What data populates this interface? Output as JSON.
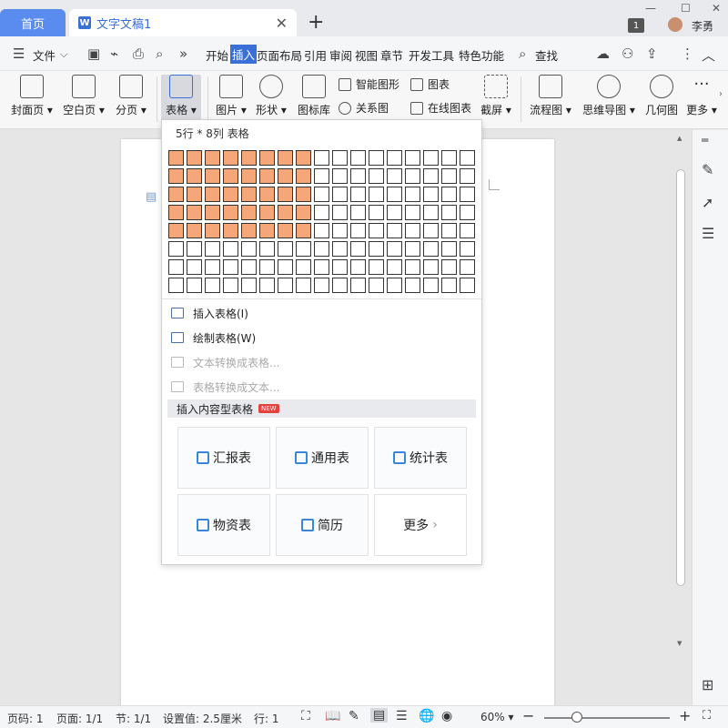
{
  "titlebar": {
    "home_tab": "首页",
    "doc_tab": "文字文稿1",
    "doc_icon_letter": "W",
    "badge": "1",
    "user_name": "李勇"
  },
  "menubar": {
    "file": "文件",
    "tabs": [
      "开始",
      "插入",
      "页面布局",
      "引用",
      "审阅",
      "视图",
      "章节",
      "开发工具",
      "特色功能"
    ],
    "active_tab": "插入",
    "search": "查找"
  },
  "ribbon": {
    "cover_page": "封面页",
    "blank_page": "空白页",
    "page_break": "分页",
    "table": "表格",
    "picture": "图片",
    "shapes": "形状",
    "icon_lib": "图标库",
    "smart_shape": "智能图形",
    "chart": "图表",
    "relation": "关系图",
    "online_chart": "在线图表",
    "screenshot": "截屏",
    "flowchart": "流程图",
    "mindmap": "思维导图",
    "geometry": "几何图",
    "more": "更多"
  },
  "dropdown": {
    "title": "5行 * 8列 表格",
    "rows_selected": 5,
    "cols_selected": 8,
    "grid_rows": 8,
    "grid_cols": 17,
    "items": [
      {
        "label": "插入表格(I)",
        "disabled": false
      },
      {
        "label": "绘制表格(W)",
        "disabled": false
      },
      {
        "label": "文本转换成表格...",
        "disabled": true
      },
      {
        "label": "表格转换成文本...",
        "disabled": true
      }
    ],
    "section_label": "插入内容型表格",
    "new_badge": "NEW",
    "cards": [
      "汇报表",
      "通用表",
      "统计表",
      "物资表",
      "简历",
      "更多"
    ]
  },
  "statusbar": {
    "page_num": "页码: 1",
    "pages": "页面: 1/1",
    "section": "节: 1/1",
    "setting": "设置值: 2.5厘米",
    "row": "行: 1",
    "zoom": "60%"
  }
}
